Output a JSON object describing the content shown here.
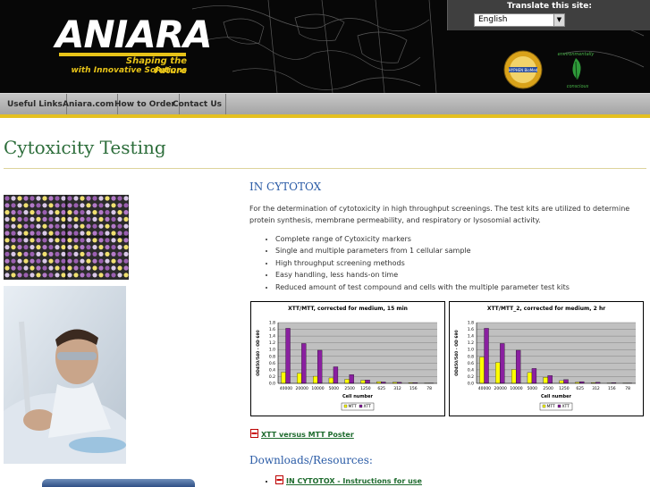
{
  "header": {
    "logo_text": "ANIARA",
    "tagline_line1": "Shaping the Future",
    "tagline_line2": "with Innovative Solutions",
    "translate_label": "Translate this site:",
    "language_selected": "English",
    "badge_icon": "hyphen-biomed-seal-icon",
    "eco_icon": "environmentally-conscious-leaf-icon",
    "badge_text": "HYPHEN BioMed",
    "eco_text_top": "environmentally",
    "eco_text_bottom": "conscious"
  },
  "nav": {
    "items": [
      {
        "label": "Useful Links"
      },
      {
        "label": "Aniara.com"
      },
      {
        "label": "How to Order"
      },
      {
        "label": "Contact Us"
      }
    ]
  },
  "page": {
    "title": "Cytoxicity Testing",
    "section_title": "IN CYTOTOX",
    "intro": "For the determination of cytotoxicity in high throughput screenings. The test kits are utilized to determine protein synthesis, membrane permeability, and respiratory or lysosomial activity.",
    "features": [
      "Complete range of Cytoxicity markers",
      "Single and multiple parameters from 1 cellular sample",
      "High throughput screening methods",
      "Easy handling, less hands-on time",
      "Reduced amount of test compound and cells with the multiple parameter test kits"
    ],
    "poster_link": "XTT versus MTT Poster",
    "downloads_title": "Downloads/Resources:",
    "downloads": [
      {
        "label": "IN CYTOTOX - Instructions for use"
      }
    ]
  },
  "colors": {
    "accent_yellow": "#e4c020",
    "title_green": "#2c6d3a",
    "link_green": "#1e6b2e",
    "section_blue": "#2a5ba6",
    "mtt_yellow": "#ffff00",
    "xtt_purple": "#8a1fa0"
  },
  "chart_data": [
    {
      "type": "bar",
      "title": "XTT/MTT, corrected for medium, 15 min",
      "xlabel": "Cell number",
      "ylabel": "OD450/540 - OD 690",
      "categories": [
        "40000",
        "20000",
        "10000",
        "5000",
        "2500",
        "1250",
        "625",
        "312",
        "156",
        "78"
      ],
      "ylim": [
        0,
        1.8
      ],
      "yticks": [
        "0.0",
        "0.2",
        "0.4",
        "0.6",
        "0.8",
        "1.0",
        "1.2",
        "1.4",
        "1.6",
        "1.8"
      ],
      "series": [
        {
          "name": "MTT",
          "color": "#ffff00",
          "values": [
            0.33,
            0.3,
            0.21,
            0.16,
            0.12,
            0.09,
            0.05,
            0.03,
            0.02,
            0.01
          ]
        },
        {
          "name": "XTT",
          "color": "#8a1fa0",
          "values": [
            1.63,
            1.18,
            0.98,
            0.49,
            0.26,
            0.1,
            0.04,
            0.03,
            0.02,
            0.01
          ]
        }
      ],
      "legend": "bottom-center",
      "grid": true
    },
    {
      "type": "bar",
      "title": "XTT/MTT_2, corrected for medium, 2 hr",
      "xlabel": "Cell number",
      "ylabel": "OD450/540 - OD 690",
      "categories": [
        "40000",
        "20000",
        "10000",
        "5000",
        "2500",
        "1250",
        "625",
        "312",
        "156",
        "78"
      ],
      "ylim": [
        0,
        1.8
      ],
      "yticks": [
        "0.0",
        "0.2",
        "0.4",
        "0.6",
        "0.8",
        "1.0",
        "1.2",
        "1.4",
        "1.6",
        "1.8"
      ],
      "series": [
        {
          "name": "MTT",
          "color": "#ffff00",
          "values": [
            0.78,
            0.62,
            0.41,
            0.32,
            0.18,
            0.08,
            0.03,
            0.02,
            0.01,
            0.01
          ]
        },
        {
          "name": "XTT",
          "color": "#8a1fa0",
          "values": [
            1.63,
            1.18,
            0.98,
            0.44,
            0.23,
            0.11,
            0.05,
            0.03,
            0.02,
            0.01
          ]
        }
      ],
      "legend": "bottom-center",
      "grid": true
    }
  ]
}
